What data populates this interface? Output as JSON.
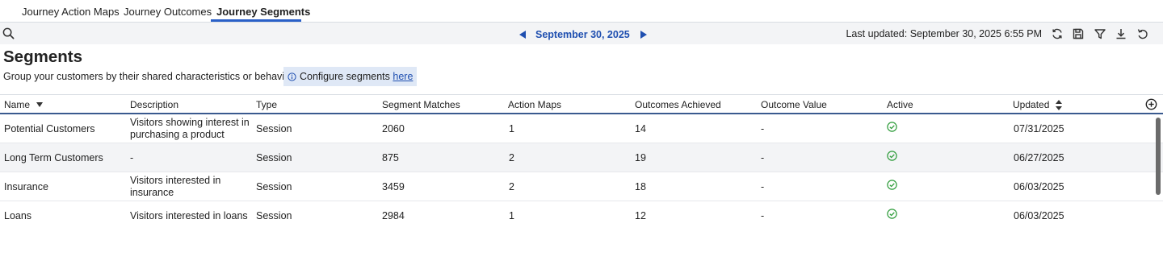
{
  "tabs": [
    {
      "label": "Journey Action Maps"
    },
    {
      "label": "Journey Outcomes"
    },
    {
      "label": "Journey Segments"
    }
  ],
  "toolbar": {
    "date": "September 30, 2025",
    "last_updated": "Last updated: September 30, 2025 6:55 PM",
    "icons": [
      "refresh-icon",
      "save-icon",
      "filter-icon",
      "download-icon",
      "undo-icon"
    ]
  },
  "header": {
    "title": "Segments",
    "subtitle": "Group your customers by their shared characteristics or behaviors.",
    "config_text": "Configure segments",
    "config_link": "here"
  },
  "table": {
    "columns": [
      "Name",
      "Description",
      "Type",
      "Segment Matches",
      "Action Maps",
      "Outcomes Achieved",
      "Outcome Value",
      "Active",
      "Updated"
    ],
    "rows": [
      {
        "name": "Potential Customers",
        "description": "Visitors showing interest in purchasing a product",
        "type": "Session",
        "matches": "2060",
        "action_maps": "1",
        "outcomes": "14",
        "value": "-",
        "active": true,
        "updated": "07/31/2025"
      },
      {
        "name": "Long Term Customers",
        "description": "-",
        "type": "Session",
        "matches": "875",
        "action_maps": "2",
        "outcomes": "19",
        "value": "-",
        "active": true,
        "updated": "06/27/2025"
      },
      {
        "name": "Insurance",
        "description": "Visitors interested in insurance",
        "type": "Session",
        "matches": "3459",
        "action_maps": "2",
        "outcomes": "18",
        "value": "-",
        "active": true,
        "updated": "06/03/2025"
      },
      {
        "name": "Loans",
        "description": "Visitors interested in loans",
        "type": "Session",
        "matches": "2984",
        "action_maps": "1",
        "outcomes": "12",
        "value": "-",
        "active": true,
        "updated": "06/03/2025"
      }
    ]
  },
  "colors": {
    "accent": "#2a60c8",
    "link": "#1f4fb0",
    "active_check": "#2e9c3a"
  }
}
